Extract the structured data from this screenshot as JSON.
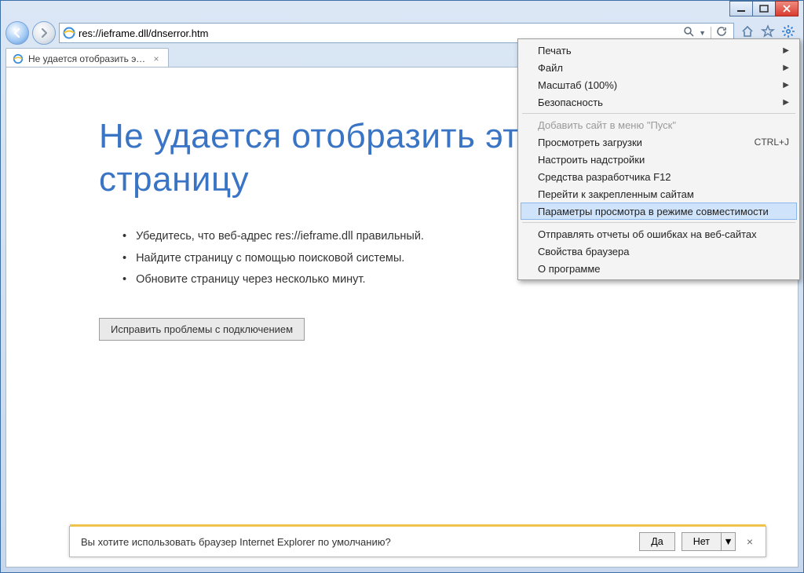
{
  "window": {
    "url": "res://ieframe.dll/dnserror.htm"
  },
  "tab": {
    "title": "Не удается отобразить эту..."
  },
  "page": {
    "heading": "Не удается отобразить эту страницу",
    "bullets": [
      "Убедитесь, что веб-адрес res://ieframe.dll правильный.",
      "Найдите страницу с помощью поисковой системы.",
      "Обновите страницу через несколько минут."
    ],
    "fix_button": "Исправить проблемы с подключением"
  },
  "menu": {
    "items": [
      {
        "label": "Печать",
        "submenu": true
      },
      {
        "label": "Файл",
        "submenu": true
      },
      {
        "label": "Масштаб (100%)",
        "submenu": true
      },
      {
        "label": "Безопасность",
        "submenu": true
      },
      {
        "sep": true
      },
      {
        "label": "Добавить сайт в меню \"Пуск\"",
        "disabled": true
      },
      {
        "label": "Просмотреть загрузки",
        "shortcut": "CTRL+J"
      },
      {
        "label": "Настроить надстройки"
      },
      {
        "label": "Средства разработчика F12"
      },
      {
        "label": "Перейти к закрепленным сайтам"
      },
      {
        "label": "Параметры просмотра в режиме совместимости",
        "hover": true
      },
      {
        "sep": true
      },
      {
        "label": "Отправлять отчеты об ошибках на веб-сайтах"
      },
      {
        "label": "Свойства браузера"
      },
      {
        "label": "О программе"
      }
    ]
  },
  "notification": {
    "text": "Вы хотите использовать браузер Internet Explorer по умолчанию?",
    "yes": "Да",
    "no": "Нет"
  }
}
